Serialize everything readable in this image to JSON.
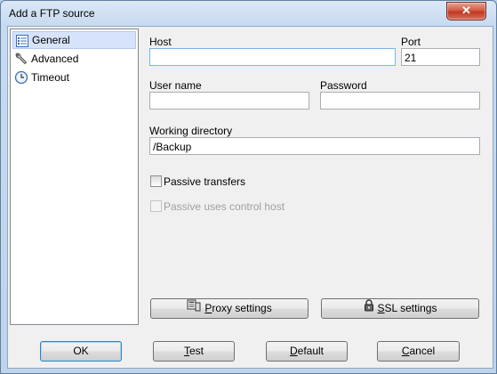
{
  "window": {
    "title": "Add a FTP source",
    "close_glyph": "✕"
  },
  "nav": {
    "items": [
      {
        "label": "General",
        "icon": "list-icon",
        "selected": true
      },
      {
        "label": "Advanced",
        "icon": "wrench-icon",
        "selected": false
      },
      {
        "label": "Timeout",
        "icon": "clock-icon",
        "selected": false
      }
    ]
  },
  "form": {
    "host_label": "Host",
    "host_value": "",
    "port_label": "Port",
    "port_value": "21",
    "username_label": "User name",
    "username_value": "",
    "password_label": "Password",
    "password_value": "",
    "workdir_label": "Working directory",
    "workdir_value": "/Backup",
    "passive_label": "Passive transfers",
    "passive_checked": false,
    "passive_control_label": "Passive uses control host",
    "passive_control_checked": false,
    "passive_control_enabled": false
  },
  "buttons": {
    "proxy_pre": "",
    "proxy_u": "P",
    "proxy_post": "roxy settings",
    "ssl_pre": "",
    "ssl_u": "S",
    "ssl_post": "SL settings",
    "ok": "OK",
    "test_u": "T",
    "test_post": "est",
    "default_u": "D",
    "default_post": "efault",
    "cancel_u": "C",
    "cancel_post": "ancel"
  },
  "colors": {
    "disabled_text": "#a0a0a0",
    "selection_bg": "#d7e3fb"
  }
}
